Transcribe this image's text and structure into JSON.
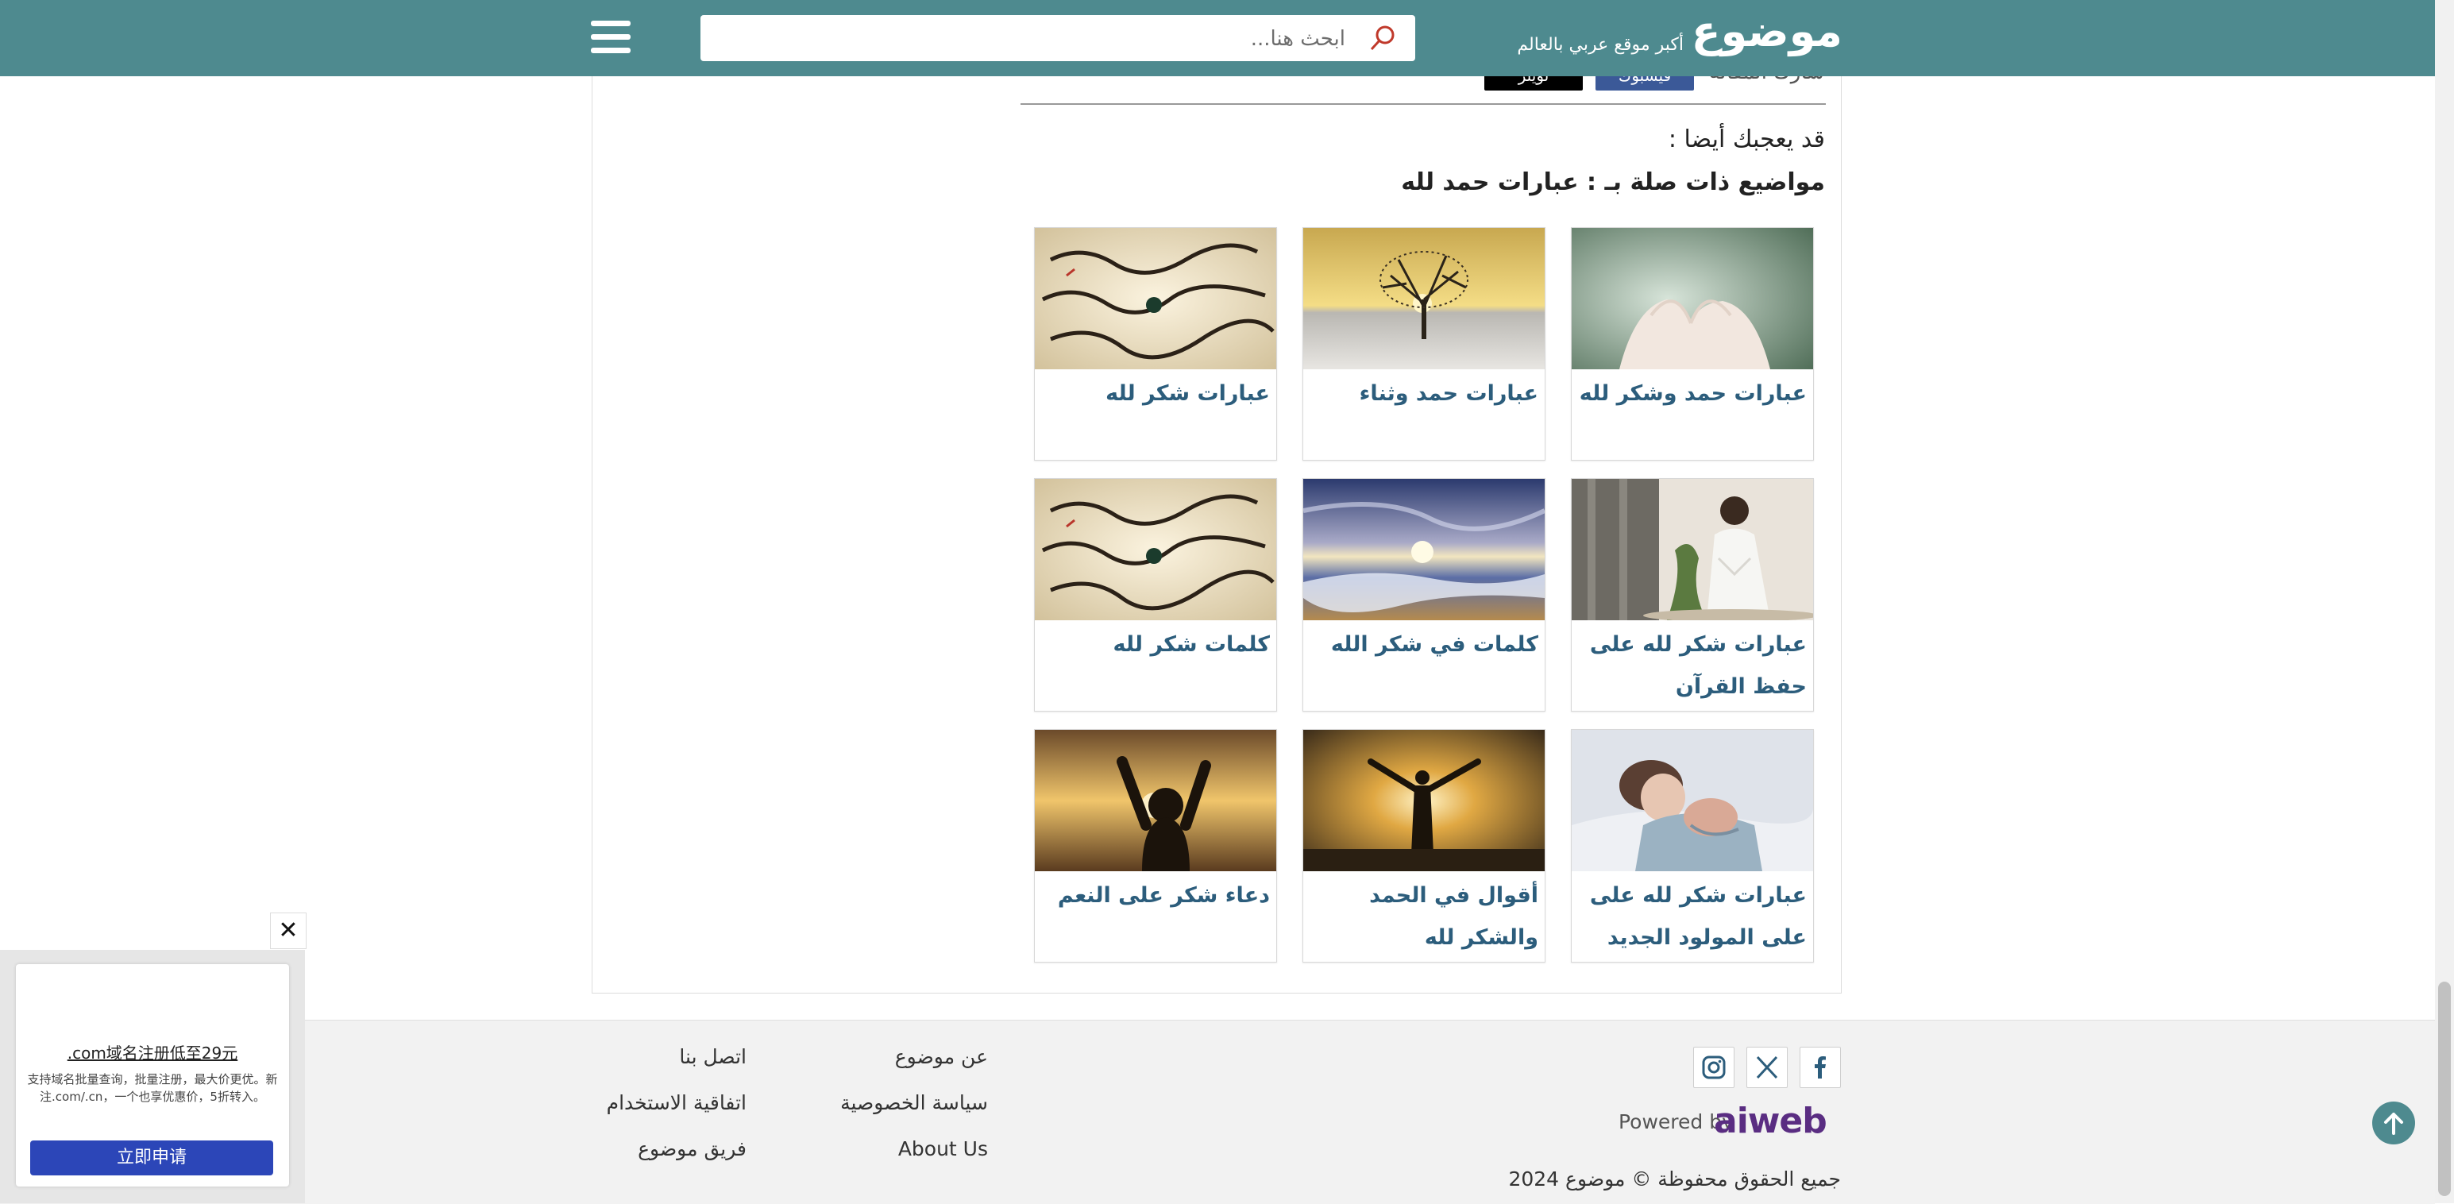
{
  "header": {
    "logo": "موضوع",
    "tagline": "أكبر موقع عربي بالعالم",
    "search_placeholder": "ابحث هنا..."
  },
  "share": {
    "label": "شارك المقالة",
    "facebook": "فيسبوك",
    "twitter": "تويتر"
  },
  "related": {
    "you_may_like": "قد يعجبك أيضا :",
    "title": "مواضيع ذات صلة بـ : عبارات حمد لله",
    "cards": [
      {
        "title": "عبارات حمد وشكر لله",
        "image": "praying-hands"
      },
      {
        "title": "عبارات حمد وثناء",
        "image": "tree-sunset"
      },
      {
        "title": "عبارات شكر لله",
        "image": "quran-text"
      },
      {
        "title": "عبارات شكر لله على حفظ القرآن",
        "image": "man-praying"
      },
      {
        "title": "كلمات في شكر الله",
        "image": "beach-sunset"
      },
      {
        "title": "كلمات شكر لله",
        "image": "quran-text"
      },
      {
        "title": "عبارات شكر لله على على المولود الجديد",
        "image": "mother-newborn"
      },
      {
        "title": "أقوال في الحمد والشكر لله",
        "image": "man-open-arms"
      },
      {
        "title": "دعاء شكر على النعم",
        "image": "raised-hands-sunset"
      }
    ]
  },
  "footer": {
    "links": {
      "about": "عن موضوع",
      "privacy": "سياسة الخصوصية",
      "about_en": "About Us",
      "contact": "اتصل بنا",
      "terms": "اتفاقية الاستخدام",
      "team": "فريق موضوع"
    },
    "powered_by": "Powered by",
    "powered_brand": "aiweb",
    "copyright": "جميع الحقوق محفوظة © موضوع 2024",
    "social": [
      "facebook-icon",
      "x-icon",
      "instagram-icon"
    ]
  },
  "ad": {
    "headline": ".com域名注册低至29元",
    "body": "支持域名批量查询，批量注册，最大价更优。新注.com/.cn，一个也享优惠价，5折转入。",
    "cta": "立即申请",
    "close": "✕"
  },
  "colors": {
    "header_bg": "#4e8a8f",
    "link": "#2c5d7c",
    "ad_button": "#2c46b8"
  }
}
